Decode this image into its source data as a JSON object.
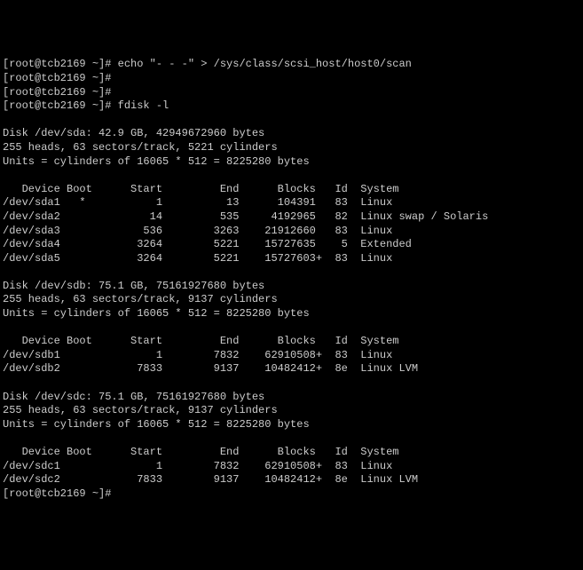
{
  "prompts": {
    "p1": "[root@tcb2169 ~]# echo \"- - -\" > /sys/class/scsi_host/host0/scan",
    "p2": "[root@tcb2169 ~]#",
    "p3": "[root@tcb2169 ~]#",
    "p4": "[root@tcb2169 ~]# fdisk -l",
    "p5": "[root@tcb2169 ~]#"
  },
  "disks": {
    "sda": {
      "header": "Disk /dev/sda: 42.9 GB, 42949672960 bytes",
      "geom": "255 heads, 63 sectors/track, 5221 cylinders",
      "units": "Units = cylinders of 16065 * 512 = 8225280 bytes",
      "cols": "   Device Boot      Start         End      Blocks   Id  System",
      "r1": "/dev/sda1   *           1          13      104391   83  Linux",
      "r2": "/dev/sda2              14         535     4192965   82  Linux swap / Solaris",
      "r3": "/dev/sda3             536        3263    21912660   83  Linux",
      "r4": "/dev/sda4            3264        5221    15727635    5  Extended",
      "r5": "/dev/sda5            3264        5221    15727603+  83  Linux"
    },
    "sdb": {
      "header": "Disk /dev/sdb: 75.1 GB, 75161927680 bytes",
      "geom": "255 heads, 63 sectors/track, 9137 cylinders",
      "units": "Units = cylinders of 16065 * 512 = 8225280 bytes",
      "cols": "   Device Boot      Start         End      Blocks   Id  System",
      "r1": "/dev/sdb1               1        7832    62910508+  83  Linux",
      "r2": "/dev/sdb2            7833        9137    10482412+  8e  Linux LVM"
    },
    "sdc": {
      "header": "Disk /dev/sdc: 75.1 GB, 75161927680 bytes",
      "geom": "255 heads, 63 sectors/track, 9137 cylinders",
      "units": "Units = cylinders of 16065 * 512 = 8225280 bytes",
      "cols": "   Device Boot      Start         End      Blocks   Id  System",
      "r1": "/dev/sdc1               1        7832    62910508+  83  Linux",
      "r2": "/dev/sdc2            7833        9137    10482412+  8e  Linux LVM"
    }
  }
}
